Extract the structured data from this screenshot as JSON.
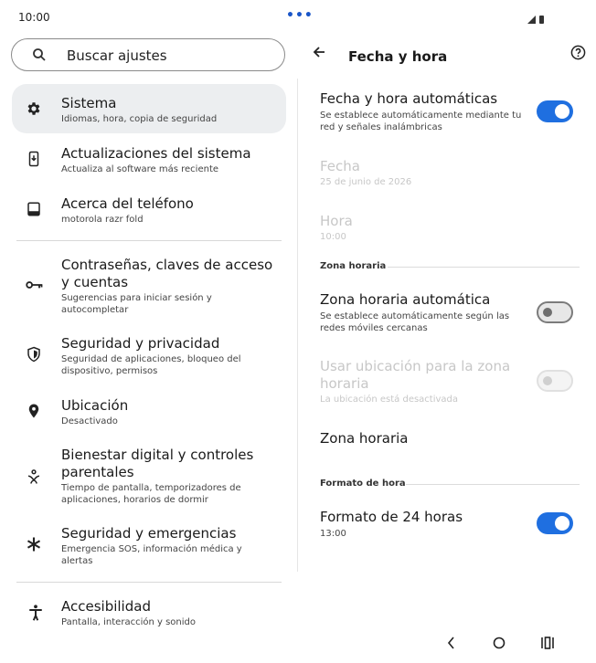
{
  "status": {
    "time": "10:00"
  },
  "search": {
    "placeholder": "Buscar ajustes"
  },
  "left_menu": [
    {
      "title": "Sistema",
      "subtitle": "Idiomas, hora, copia de seguridad",
      "icon": "gear-icon",
      "selected": true
    },
    {
      "title": "Actualizaciones del sistema",
      "subtitle": "Actualiza al software más reciente",
      "icon": "system-update-icon"
    },
    {
      "title": "Acerca del teléfono",
      "subtitle": "motorola razr fold",
      "icon": "phone-icon"
    },
    {
      "title": "Contraseñas, claves de acceso y cuentas",
      "subtitle": "Sugerencias para iniciar sesión y autocompletar",
      "icon": "key-icon"
    },
    {
      "title": "Seguridad y privacidad",
      "subtitle": "Seguridad de aplicaciones, bloqueo del dispositivo, permisos",
      "icon": "shield-icon"
    },
    {
      "title": "Ubicación",
      "subtitle": "Desactivado",
      "icon": "location-pin-icon"
    },
    {
      "title": "Bienestar digital y controles parentales",
      "subtitle": "Tiempo de pantalla, temporizadores de aplicaciones, horarios de dormir",
      "icon": "wellbeing-icon"
    },
    {
      "title": "Seguridad y emergencias",
      "subtitle": "Emergencia SOS, información médica y alertas",
      "icon": "asterisk-icon"
    },
    {
      "title": "Accesibilidad",
      "subtitle": "Pantalla, interacción y sonido",
      "icon": "accessibility-icon"
    }
  ],
  "right": {
    "title": "Fecha y hora",
    "auto_datetime": {
      "title": "Fecha y hora automáticas",
      "subtitle": "Se establece automáticamente mediante tu red y señales inalámbricas",
      "toggle": "on"
    },
    "date": {
      "title": "Fecha",
      "value": "25 de junio de 2026"
    },
    "time": {
      "title": "Hora",
      "value": "10:00"
    },
    "section_timezone": "Zona horaria",
    "auto_timezone": {
      "title": "Zona horaria automática",
      "subtitle": "Se establece automáticamente según las redes móviles cercanas",
      "toggle": "off"
    },
    "use_location": {
      "title": "Usar ubicación para la zona horaria",
      "subtitle": "La ubicación está desactivada",
      "toggle": "disabled"
    },
    "timezone": {
      "title": "Zona horaria"
    },
    "section_format": "Formato de hora",
    "format24": {
      "title": "Formato de 24 horas",
      "subtitle": "13:00",
      "toggle": "on"
    }
  },
  "colors": {
    "accent": "#1f6fe0",
    "selected_bg": "#eceef0"
  }
}
